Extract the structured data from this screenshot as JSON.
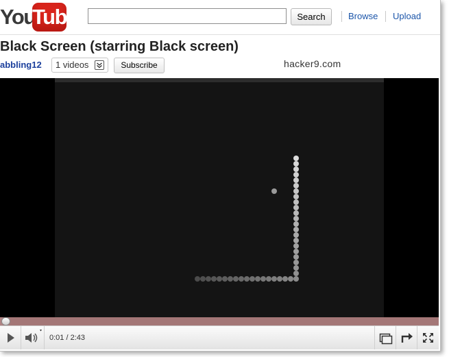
{
  "header": {
    "logo_you": "You",
    "logo_tube": "Tube",
    "search_value": "",
    "search_label": "Search",
    "nav": {
      "browse": "Browse",
      "upload": "Upload"
    }
  },
  "video": {
    "title": "Black Screen (starring Black screen)",
    "channel": "abbling12",
    "videos_count": "1 videos",
    "subscribe_label": "Subscribe",
    "watermark": "hacker9.com"
  },
  "player": {
    "time": "0:01 / 2:43",
    "progress_fraction": 0.006,
    "colors": {
      "background": "#000000",
      "game_area": "#141414",
      "snake": "#9a9a9a",
      "food": "#9a9a9a",
      "progress": "#a47777"
    },
    "icons": [
      "play-icon",
      "volume-icon",
      "miniplayer-icon",
      "popout-icon",
      "fullscreen-icon"
    ]
  },
  "game": {
    "type": "snake",
    "snake_cells": 25,
    "food_cells": 1
  }
}
